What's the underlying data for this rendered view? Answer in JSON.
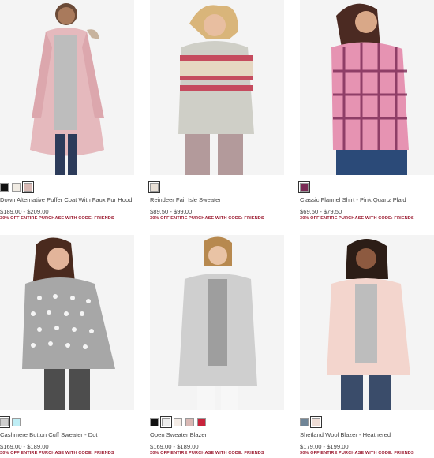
{
  "products": [
    {
      "name": "Down Alternative Puffer Coat With Faux Fur Hood",
      "price": "$189.00 - $209.00",
      "promo": "30% OFF ENTIRE PURCHASE WITH CODE: FRIENDS",
      "swatches": [
        "#111111",
        "#f1ece4",
        "#d8b9b4"
      ]
    },
    {
      "name": "Reindeer Fair Isle Sweater",
      "price": "$89.50 - $99.00",
      "promo": "30% OFF ENTIRE PURCHASE WITH CODE: FRIENDS",
      "swatches": [
        "#e9e0d6"
      ]
    },
    {
      "name": "Classic Flannel Shirt - Pink Quartz Plaid",
      "price": "$69.50 - $79.50",
      "promo": "30% OFF ENTIRE PURCHASE WITH CODE: FRIENDS",
      "swatches": [
        "#7a2a55"
      ]
    },
    {
      "name": "Cashmere Button Cuff Sweater - Dot",
      "price": "$169.00 - $189.00",
      "promo": "30% OFF ENTIRE PURCHASE WITH CODE: FRIENDS",
      "swatches": [
        "#cfcfcf",
        "#bfeef5"
      ]
    },
    {
      "name": "Open Sweater Blazer",
      "price": "$169.00 - $189.00",
      "promo": "30% OFF ENTIRE PURCHASE WITH CODE: FRIENDS",
      "swatches": [
        "#111111",
        "#ededed",
        "#f4ece6",
        "#d9b8b4",
        "#c8233b"
      ]
    },
    {
      "name": "Shetland Wool Blazer - Heathered",
      "price": "$179.00 - $199.00",
      "promo": "30% OFF ENTIRE PURCHASE WITH CODE: FRIENDS",
      "swatches": [
        "#6f8597",
        "#efddd6"
      ]
    }
  ]
}
